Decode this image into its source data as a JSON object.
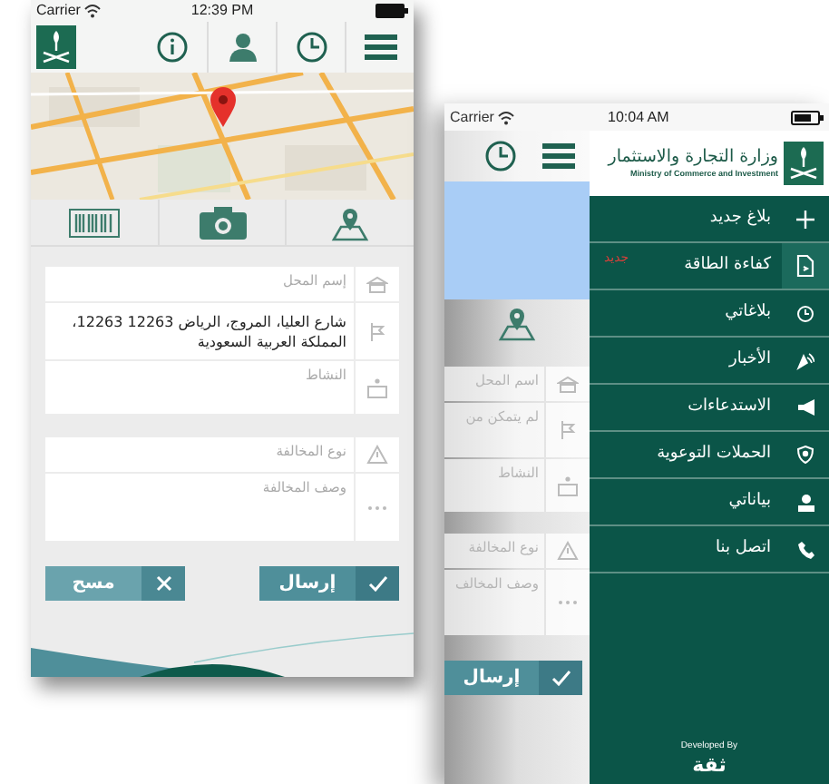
{
  "left_screen": {
    "status_bar": {
      "carrier": "Carrier",
      "time": "12:39 PM"
    },
    "form_groups": [
      {
        "fields": [
          {
            "kind": "name",
            "placeholder": "إسم المحل"
          },
          {
            "kind": "address",
            "value": "شارع العليا، المروج، الرياض 12263 12263، المملكة العربية السعودية"
          },
          {
            "kind": "activity",
            "placeholder": "النشاط"
          }
        ]
      },
      {
        "fields": [
          {
            "kind": "warning",
            "placeholder": "نوع المخالفة"
          },
          {
            "kind": "description",
            "placeholder": "وصف المخالفة"
          }
        ]
      }
    ],
    "buttons": [
      {
        "kind": "send",
        "label": "إرسال"
      },
      {
        "kind": "clear",
        "label": "مسح"
      }
    ]
  },
  "right_screen": {
    "status_bar": {
      "carrier": "Carrier",
      "time": "10:04 AM"
    },
    "header": {
      "title": "وزارة التجارة والاستثمار",
      "subtitle": "Ministry of Commerce and Investment"
    },
    "menu": [
      {
        "label": "بلاغ جديد",
        "selected": false
      },
      {
        "label": "كفاءة الطاقة",
        "selected": true,
        "badge": "جديد"
      },
      {
        "label": "بلاغاتي",
        "selected": false
      },
      {
        "label": "الأخبار",
        "selected": false
      },
      {
        "label": "الاستدعاءات",
        "selected": false
      },
      {
        "label": "الحملات التوعوية",
        "selected": false
      },
      {
        "label": "بياناتي",
        "selected": false
      },
      {
        "label": "اتصل بنا",
        "selected": false
      }
    ],
    "background_form": {
      "fields": [
        "اسم المحل",
        "لم يتمكن من",
        "النشاط",
        "نوع المخالفة",
        "وصف المخالف"
      ],
      "button": "إرسال"
    },
    "footer": {
      "caption": "Developed By",
      "logo_text": "ثقة"
    }
  }
}
